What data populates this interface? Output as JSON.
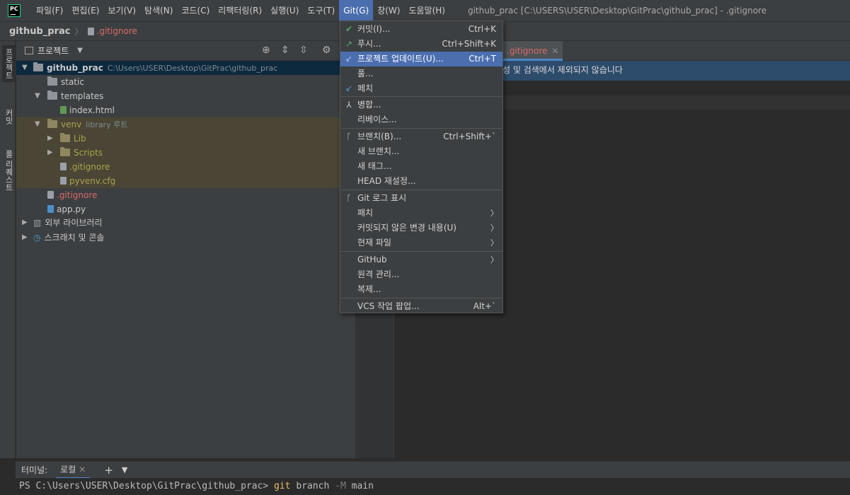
{
  "app": {
    "logo_text": "PC",
    "window_title": "github_prac [C:\\USERS\\USER\\Desktop\\GitPrac\\github_prac] - .gitignore"
  },
  "menu": [
    "파일(F)",
    "편집(E)",
    "보기(V)",
    "탐색(N)",
    "코드(C)",
    "리팩터링(R)",
    "실행(U)",
    "도구(T)",
    "Git(G)",
    "창(W)",
    "도움말(H)"
  ],
  "breadcrumb": {
    "project": "github_prac",
    "file": ".gitignore"
  },
  "left_strip": {
    "project_tab": "프로젝트",
    "commit_tab": "커밋",
    "pull_requests_tab": "풀 리퀘스트"
  },
  "project_panel": {
    "title": "프로젝트",
    "tree": [
      {
        "label": "github_prac",
        "extra": "C:\\Users\\USER\\Desktop\\GitPrac\\github_prac"
      },
      {
        "label": "static"
      },
      {
        "label": "templates"
      },
      {
        "label": "index.html"
      },
      {
        "label": "venv",
        "extra": "library 루트"
      },
      {
        "label": "Lib"
      },
      {
        "label": "Scripts"
      },
      {
        "label": ".gitignore"
      },
      {
        "label": "pyvenv.cfg"
      },
      {
        "label": ".gitignore"
      },
      {
        "label": "app.py"
      },
      {
        "label": "외부 라이브러리"
      },
      {
        "label": "스크래치 및 콘솔"
      }
    ]
  },
  "editor": {
    "tab_label": ".gitignore",
    "banner_text": "성 및 검색에서 제외되지 않습니다"
  },
  "git_menu": {
    "items": [
      {
        "label": "커밋(I)...",
        "shortcut": "Ctrl+K"
      },
      {
        "label": "푸시...",
        "shortcut": "Ctrl+Shift+K"
      },
      {
        "label": "프로젝트 업데이트(U)...",
        "shortcut": "Ctrl+T"
      },
      {
        "label": "풀..."
      },
      {
        "label": "페치"
      },
      {
        "label": "병합..."
      },
      {
        "label": "리베이스..."
      },
      {
        "label": "브랜치(B)...",
        "shortcut": "Ctrl+Shift+`"
      },
      {
        "label": "새 브랜치..."
      },
      {
        "label": "새 태그..."
      },
      {
        "label": "HEAD 재설정..."
      },
      {
        "label": "Git 로그 표시"
      },
      {
        "label": "패치"
      },
      {
        "label": "커밋되지 않은 변경 내용(U)"
      },
      {
        "label": "현재 파일"
      },
      {
        "label": "GitHub"
      },
      {
        "label": "원격 관리..."
      },
      {
        "label": "복제..."
      },
      {
        "label": "VCS 작업 팝업...",
        "shortcut": "Alt+`"
      }
    ]
  },
  "terminal": {
    "label": "터미널:",
    "tab": "로컬",
    "prompt": "PS C:\\Users\\USER\\Desktop\\GitPrac\\github_prac>",
    "cmd_git": "git",
    "cmd_branch": "branch",
    "cmd_flag": "-M",
    "cmd_arg": "main"
  },
  "colors": {
    "accent": "#4b6eaf",
    "vcs_red": "#d96a6a",
    "html_green": "#629755",
    "venv_olive": "#a9a44b"
  }
}
